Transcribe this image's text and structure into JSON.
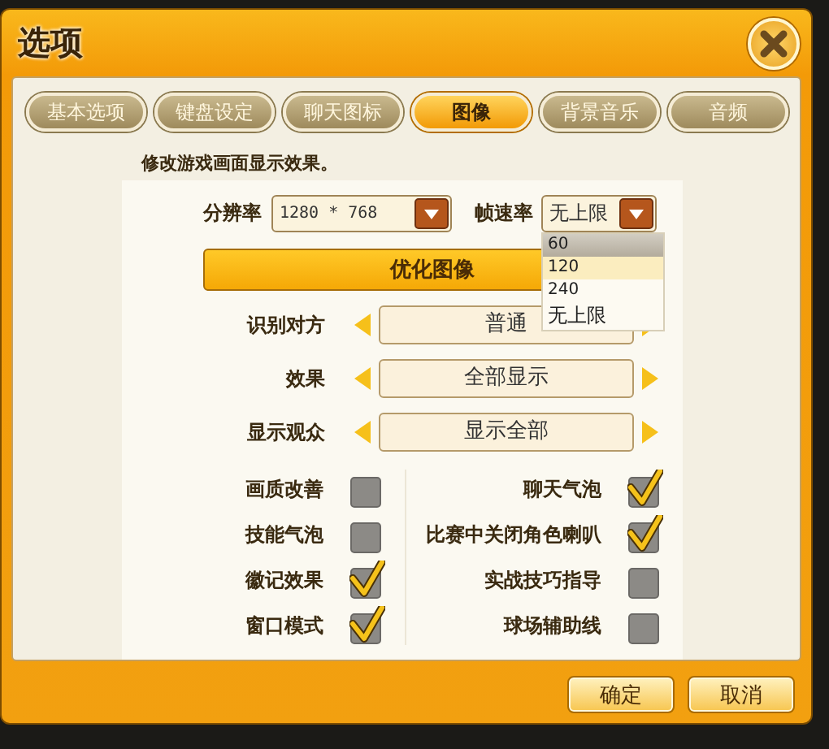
{
  "window": {
    "title": "选项"
  },
  "tabs": [
    {
      "label": "基本选项",
      "selected": false
    },
    {
      "label": "键盘设定",
      "selected": false
    },
    {
      "label": "聊天图标",
      "selected": false
    },
    {
      "label": "图像",
      "selected": true
    },
    {
      "label": "背景音乐",
      "selected": false
    },
    {
      "label": "音频",
      "selected": false
    }
  ],
  "description": "修改游戏画面显示效果。",
  "resolution": {
    "label": "分辨率",
    "value": "1280 * 768"
  },
  "frame_rate": {
    "label": "帧速率",
    "value": "无上限",
    "expanded": true,
    "options": [
      {
        "label": "60",
        "highlighted": true,
        "hovered": false
      },
      {
        "label": "120",
        "highlighted": false,
        "hovered": true
      },
      {
        "label": "240",
        "highlighted": false,
        "hovered": false
      },
      {
        "label": "无上限",
        "highlighted": false,
        "hovered": false
      }
    ]
  },
  "optimize_button": "优化图像",
  "selectors": [
    {
      "label": "识别对方",
      "value": "普通"
    },
    {
      "label": "效果",
      "value": "全部显示"
    },
    {
      "label": "显示观众",
      "value": "显示全部"
    }
  ],
  "checkboxes_left": [
    {
      "label": "画质改善",
      "checked": false
    },
    {
      "label": "技能气泡",
      "checked": false
    },
    {
      "label": "徽记效果",
      "checked": true
    },
    {
      "label": "窗口模式",
      "checked": true
    }
  ],
  "checkboxes_right": [
    {
      "label": "聊天气泡",
      "checked": true
    },
    {
      "label": "比赛中关闭角色喇叭",
      "checked": true
    },
    {
      "label": "实战技巧指导",
      "checked": false
    },
    {
      "label": "球场辅助线",
      "checked": false
    }
  ],
  "buttons": [
    "确定",
    "取消"
  ]
}
